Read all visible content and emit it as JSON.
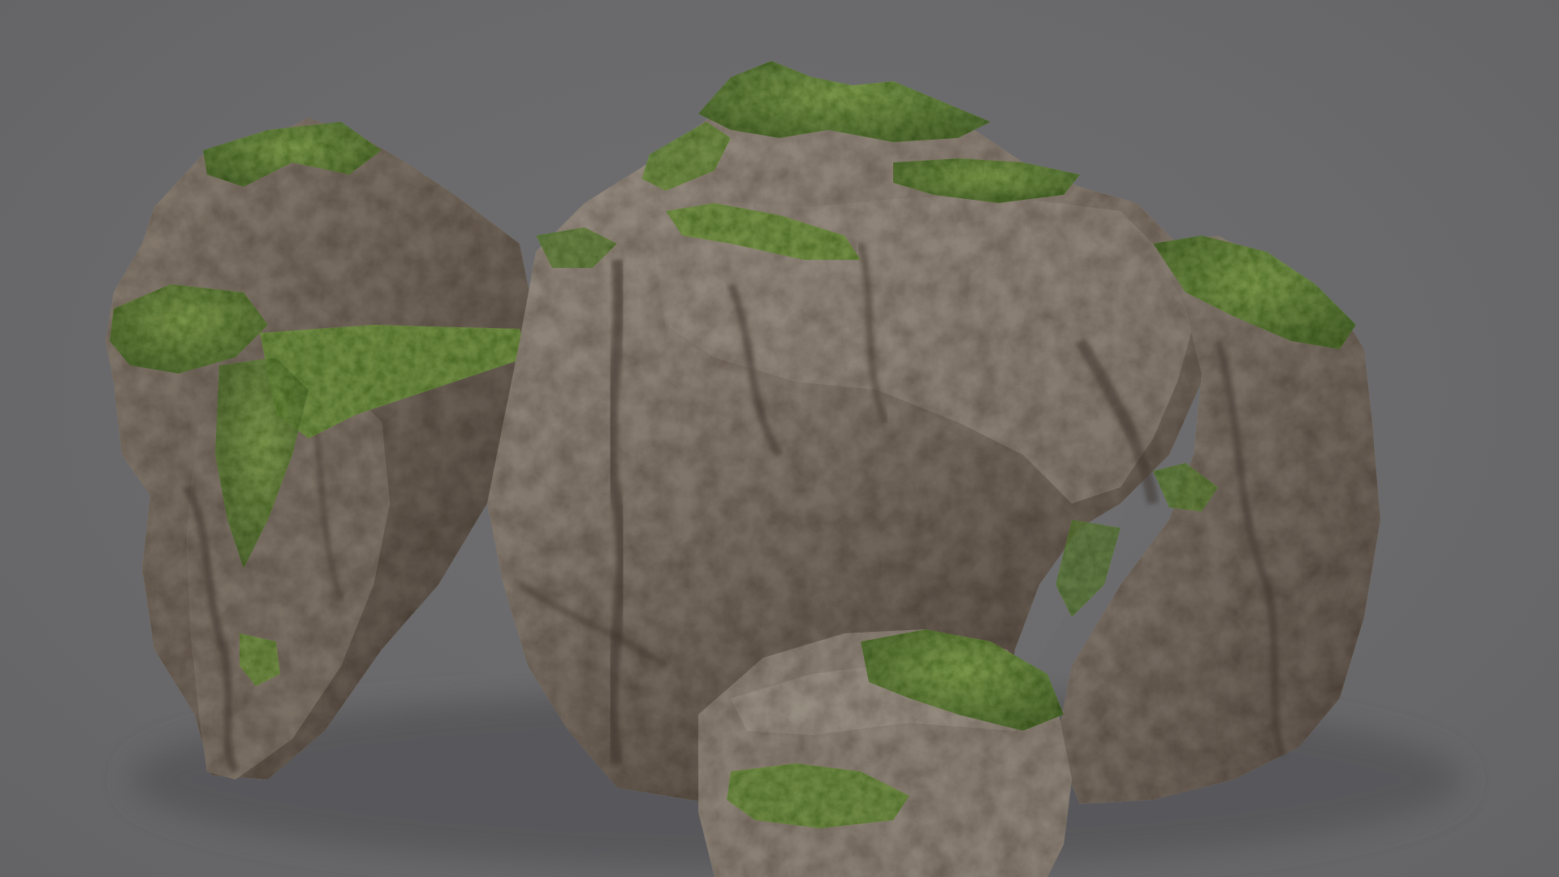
{
  "scene": {
    "subject": "moss-covered-rock-3d-model",
    "background_color": "#6b6b6d",
    "rock_base_color": "#7b7066",
    "rock_highlight_color": "#a89e92",
    "rock_shadow_color": "#3e3731",
    "moss_color": "#5f7d3a",
    "moss_highlight_color": "#7f9e4c",
    "shadow_color": "#58585a"
  }
}
